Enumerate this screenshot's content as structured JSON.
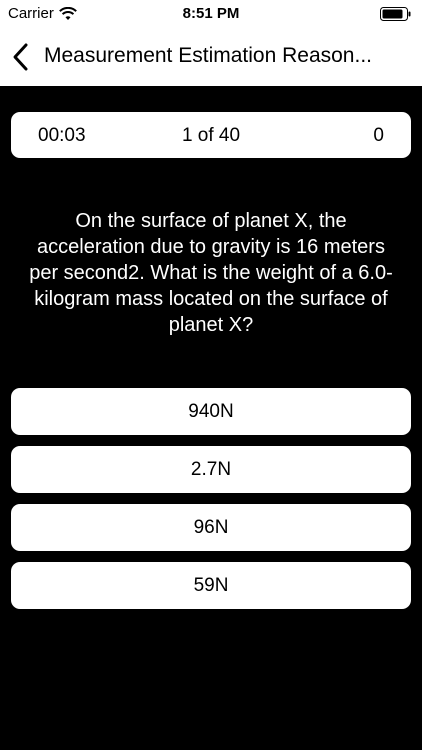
{
  "status_bar": {
    "carrier": "Carrier",
    "time": "8:51 PM"
  },
  "nav": {
    "title": "Measurement Estimation Reason..."
  },
  "quiz": {
    "timer": "00:03",
    "progress": "1 of 40",
    "score": "0",
    "question": "On the surface of planet X, the acceleration due to gravity is 16 meters per second2. What is the weight of a 6.0-kilogram mass located on the surface of planet X?",
    "answers": [
      "940N",
      "2.7N",
      "96N",
      "59N"
    ]
  },
  "icons": {
    "wifi": "wifi-icon",
    "battery": "battery-icon",
    "back": "chevron-left-icon"
  },
  "colors": {
    "background": "#000000",
    "card": "#ffffff",
    "text_dark": "#000000",
    "text_light": "#ffffff"
  }
}
